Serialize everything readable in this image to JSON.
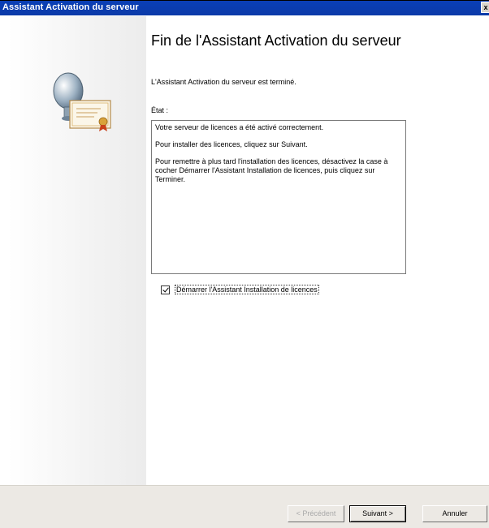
{
  "window": {
    "title": "Assistant Activation du serveur",
    "close_symbol": "x"
  },
  "main": {
    "heading": "Fin de l'Assistant Activation du serveur",
    "subtext": "L'Assistant Activation du serveur est terminé.",
    "state_label": "État :",
    "state_paragraphs": [
      "Votre serveur de licences a été activé correctement.",
      "Pour installer des licences, cliquez sur Suivant.",
      "Pour remettre à plus tard l'installation des licences, désactivez la case à cocher Démarrer l'Assistant Installation de licences, puis cliquez sur Terminer."
    ],
    "checkbox_label": "Démarrer l'Assistant Installation de licences",
    "checkbox_checked": true
  },
  "buttons": {
    "prev": "< Précédent",
    "next": "Suivant >",
    "cancel": "Annuler"
  },
  "colors": {
    "titlebar": "#0a3fb6",
    "bottom_bar": "#ece9e4"
  },
  "icons": {
    "wizard": "server-certificate-icon"
  }
}
